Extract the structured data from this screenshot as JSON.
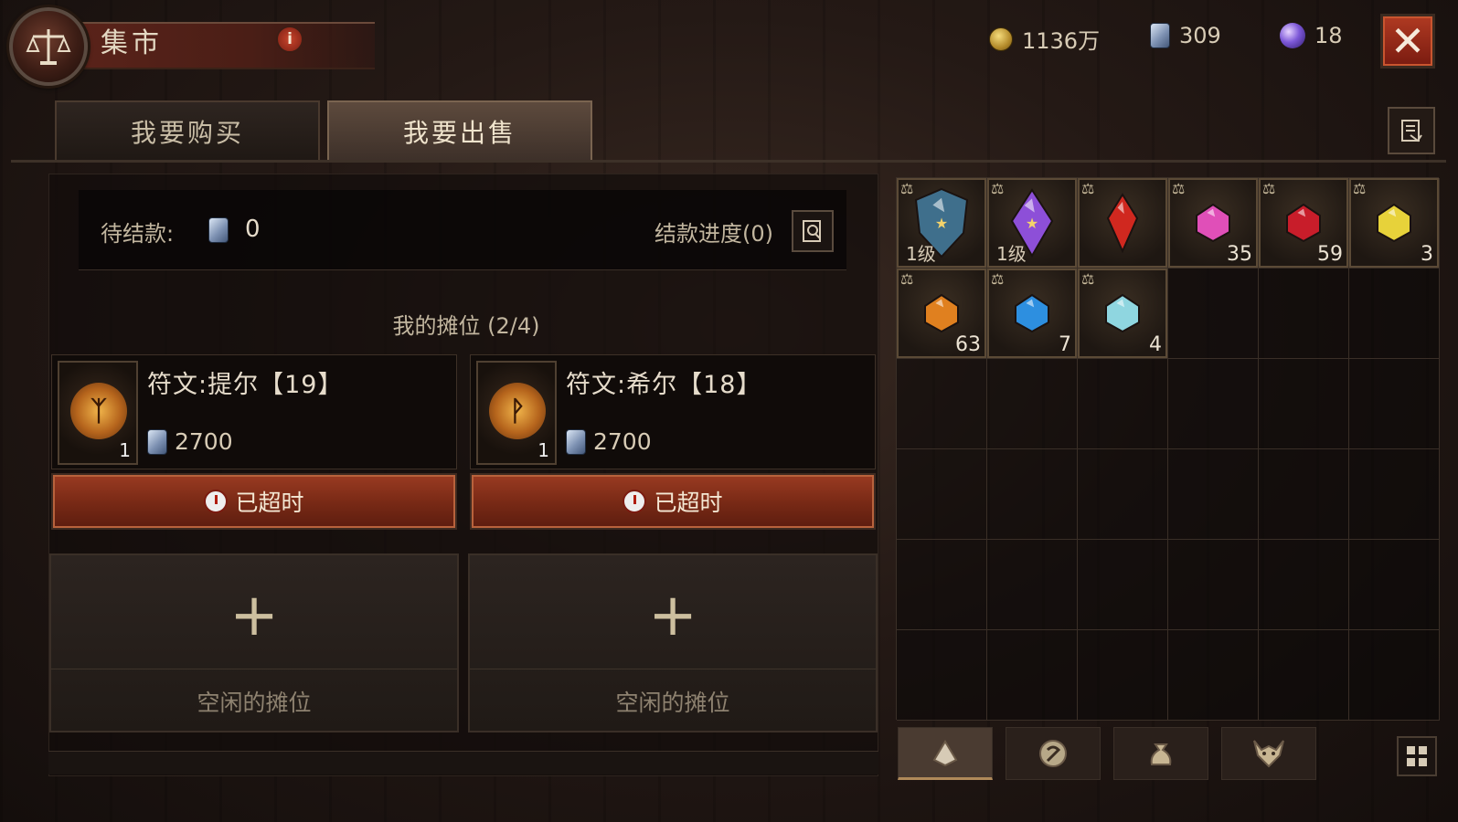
{
  "header": {
    "title": "集市",
    "info_icon": "info-icon",
    "currencies": [
      {
        "icon": "gold-coin-icon",
        "value": "1136万"
      },
      {
        "icon": "platinum-icon",
        "value": "309"
      },
      {
        "icon": "purple-orb-icon",
        "value": "18"
      }
    ],
    "close_icon": "close-icon"
  },
  "tabs": [
    {
      "label": "我要购买",
      "active": false
    },
    {
      "label": "我要出售",
      "active": true
    }
  ],
  "pending": {
    "label": "待结款:",
    "value": "0",
    "progress_label": "结款进度(0)"
  },
  "stalls": {
    "title": "我的摊位 (2/4)",
    "listings": [
      {
        "name": "符文:提尔【19】",
        "count": "1",
        "price": "2700",
        "status": "已超时",
        "rune_glyph": "ᛉ"
      },
      {
        "name": "符文:希尔【18】",
        "count": "1",
        "price": "2700",
        "status": "已超时",
        "rune_glyph": "ᚹ"
      }
    ],
    "empty_label": "空闲的摊位"
  },
  "inventory": {
    "items": [
      {
        "type": "shield-item",
        "level": "1级",
        "qty": "",
        "color": "#3f6f8c"
      },
      {
        "type": "purple-crystal",
        "level": "1级",
        "qty": "",
        "color": "#8d4fd8"
      },
      {
        "type": "red-crystal",
        "level": "",
        "qty": "",
        "color": "#d0281f"
      },
      {
        "type": "pink-gem",
        "level": "",
        "qty": "35",
        "color": "#e04fb8"
      },
      {
        "type": "red-gem",
        "level": "",
        "qty": "59",
        "color": "#c81d2a"
      },
      {
        "type": "yellow-gem",
        "level": "",
        "qty": "3",
        "color": "#e7d23a"
      },
      {
        "type": "orange-gem",
        "level": "",
        "qty": "63",
        "color": "#e0801f"
      },
      {
        "type": "blue-gem",
        "level": "",
        "qty": "7",
        "color": "#2d8fe0"
      },
      {
        "type": "cyan-gem",
        "level": "",
        "qty": "4",
        "color": "#8fd6e0"
      }
    ],
    "tabs": [
      "rune-tab-icon",
      "charm-tab-icon",
      "bag-tab-icon",
      "demon-tab-icon"
    ]
  }
}
